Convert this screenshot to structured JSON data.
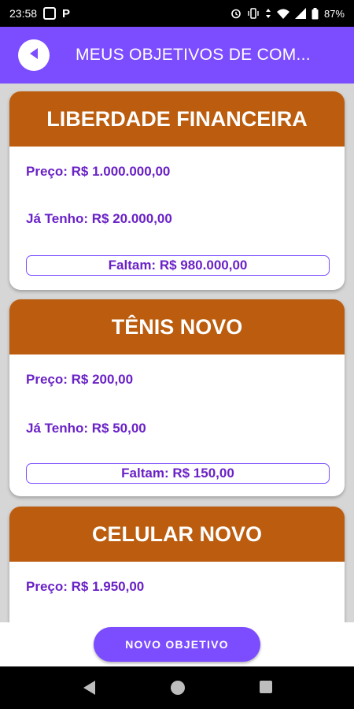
{
  "status_bar": {
    "time": "23:58",
    "battery": "87%",
    "icons": [
      "photo-app-icon",
      "p-app-icon",
      "alarm-icon",
      "vibrate-icon",
      "data-arrows-icon",
      "wifi-icon",
      "signal-icon",
      "battery-icon"
    ]
  },
  "app_bar": {
    "title": "MEUS OBJETIVOS DE COM...",
    "back_icon": "back-arrow-icon"
  },
  "goals": [
    {
      "name": "LIBERDADE FINANCEIRA",
      "price": "Preço: R$ 1.000.000,00",
      "have": "Já Tenho: R$ 20.000,00",
      "remaining": "Faltam: R$ 980.000,00"
    },
    {
      "name": "TÊNIS NOVO",
      "price": "Preço: R$ 200,00",
      "have": "Já Tenho: R$ 50,00",
      "remaining": "Faltam: R$ 150,00"
    },
    {
      "name": "CELULAR NOVO",
      "price": "Preço: R$ 1.950,00"
    }
  ],
  "new_goal_button": "NOVO OBJETIVO",
  "colors": {
    "primary": "#7c4dff",
    "card_header": "#bb5c0e",
    "card_text": "#6a22c7"
  },
  "nav_bar": {
    "icons": [
      "nav-back-icon",
      "nav-home-icon",
      "nav-recents-icon"
    ]
  }
}
